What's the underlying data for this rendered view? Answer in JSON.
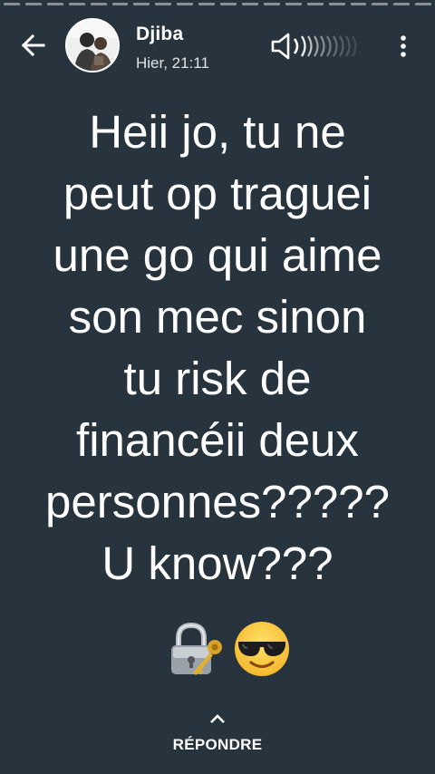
{
  "header": {
    "sender_name": "Djiba",
    "timestamp": "Hier, 21:11"
  },
  "status": {
    "lines": [
      "Heii jo, tu ne",
      "peut op traguei",
      "une go qui aime",
      "son mec sinon",
      "tu risk de",
      "financéii deux",
      "personnes?????",
      "U know???"
    ],
    "emojis": [
      "lock-with-key-emoji",
      "smiling-face-with-sunglasses-emoji"
    ]
  },
  "footer": {
    "reply_label": "RÉPONDRE"
  },
  "progress": {
    "segments": 20,
    "completed": 0
  },
  "colors": {
    "background": "#28343d",
    "text": "#ffffff"
  },
  "icons": {
    "back": "arrow-left-icon",
    "speaker": "speaker-volume-icon",
    "menu": "more-vertical-icon",
    "reply": "chevron-up-icon"
  }
}
